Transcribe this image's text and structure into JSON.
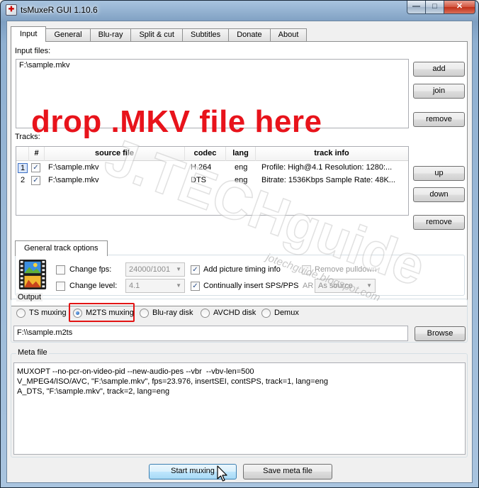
{
  "window": {
    "title": "tsMuxeR GUI 1.10.6",
    "minimize_glyph": "—",
    "maximize_glyph": "□",
    "close_glyph": "✕"
  },
  "tabs": [
    "Input",
    "General",
    "Blu-ray",
    "Split & cut",
    "Subtitles",
    "Donate",
    "About"
  ],
  "input": {
    "input_files_label": "Input files:",
    "files": [
      "F:\\sample.mkv"
    ],
    "drop_hint": "drop .MKV file here",
    "add_button": "add",
    "join_button": "join",
    "remove_file_button": "remove"
  },
  "tracks": {
    "label": "Tracks:",
    "columns": [
      "#",
      "source file",
      "codec",
      "lang",
      "track info"
    ],
    "rows": [
      {
        "num": "1",
        "checked": true,
        "source": "F:\\sample.mkv",
        "codec": "H.264",
        "lang": "eng",
        "info": "Profile: High@4.1  Resolution: 1280:..."
      },
      {
        "num": "2",
        "checked": true,
        "source": "F:\\sample.mkv",
        "codec": "DTS",
        "lang": "eng",
        "info": "Bitrate: 1536Kbps  Sample Rate: 48K..."
      }
    ],
    "up_button": "up",
    "down_button": "down",
    "remove_button": "remove"
  },
  "track_options": {
    "tab_label": "General track options",
    "change_fps_label": "Change fps:",
    "fps_value": "24000/1001",
    "change_level_label": "Change level:",
    "level_value": "4.1",
    "add_timing_label": "Add picture timing info",
    "insert_sps_label": "Continually insert SPS/PPS",
    "remove_pulldown_label": "Remove pulldown",
    "ar_label": "AR",
    "ar_value": "As source"
  },
  "output": {
    "label": "Output",
    "modes": [
      "TS muxing",
      "M2TS muxing",
      "Blu-ray disk",
      "AVCHD disk",
      "Demux"
    ],
    "selected": "M2TS muxing",
    "path": "F:\\\\sample.m2ts",
    "browse_button": "Browse"
  },
  "meta": {
    "label": "Meta file",
    "lines": [
      "MUXOPT --no-pcr-on-video-pid --new-audio-pes --vbr  --vbv-len=500",
      "V_MPEG4/ISO/AVC, \"F:\\sample.mkv\", fps=23.976, insertSEI, contSPS, track=1, lang=eng",
      "A_DTS, \"F:\\sample.mkv\", track=2, lang=eng"
    ]
  },
  "actions": {
    "start_button": "Start muxing",
    "save_meta_button": "Save meta file"
  },
  "watermark": {
    "brand": "J.TECHguide",
    "url": "jotechguide.blogspot.com"
  },
  "colors": {
    "highlight_red": "#e21414",
    "drop_text_red": "#e8131b"
  }
}
